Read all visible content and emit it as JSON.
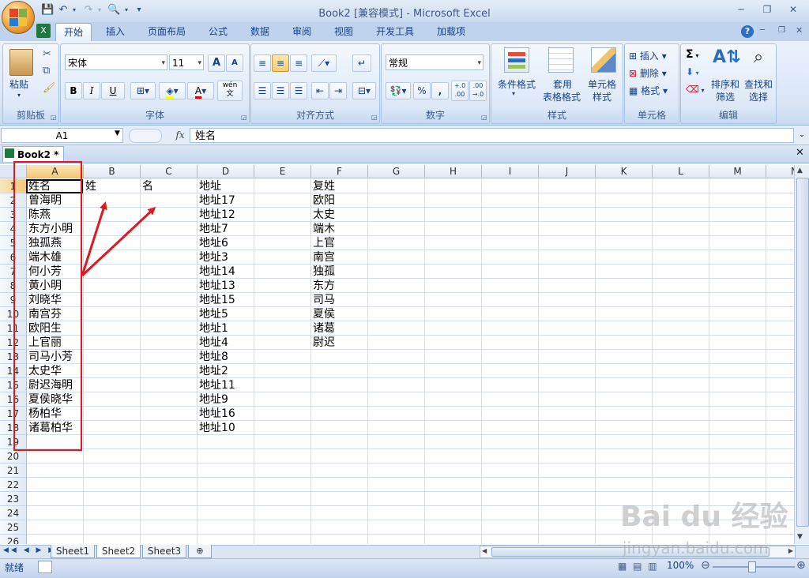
{
  "window": {
    "title": "Book2  [兼容模式] - Microsoft Excel",
    "minimize": "─",
    "restore": "❐",
    "close": "✕"
  },
  "ribbon": {
    "tabs": [
      "开始",
      "插入",
      "页面布局",
      "公式",
      "数据",
      "审阅",
      "视图",
      "开发工具",
      "加载项"
    ],
    "active_tab": "开始",
    "help_icon": "?",
    "groups": {
      "clipboard": {
        "label": "剪贴板",
        "paste": "粘贴"
      },
      "font": {
        "label": "字体",
        "font_name": "宋体",
        "font_size": "11",
        "bold": "B",
        "italic": "I",
        "underline": "U",
        "grow": "A",
        "shrink": "A",
        "wen": "wén\n文"
      },
      "alignment": {
        "label": "对齐方式"
      },
      "number": {
        "label": "数字",
        "format": "常规",
        "percent": "%",
        "comma": ",",
        "inc_dec": "+.0\n.00",
        "dec_dec": ".00\n→.0"
      },
      "styles": {
        "label": "样式",
        "conditional": "条件格式",
        "table_format_line1": "套用",
        "table_format_line2": "表格格式",
        "cell_style_line1": "单元格",
        "cell_style_line2": "样式"
      },
      "cells": {
        "label": "单元格",
        "insert": "插入",
        "delete": "删除",
        "format": "格式"
      },
      "editing": {
        "label": "编辑",
        "sum": "Σ",
        "sort_line1": "排序和",
        "sort_line2": "筛选",
        "find_line1": "查找和",
        "find_line2": "选择"
      }
    }
  },
  "formula_bar": {
    "name_box": "A1",
    "fx": "fx",
    "content": "姓名"
  },
  "workbook_tab": {
    "label": "Book2 *"
  },
  "grid": {
    "columns": [
      "A",
      "B",
      "C",
      "D",
      "E",
      "F",
      "G",
      "H",
      "I",
      "J",
      "K",
      "L",
      "M",
      "N"
    ],
    "rows": [
      "1",
      "2",
      "3",
      "4",
      "5",
      "6",
      "7",
      "8",
      "9",
      "10",
      "11",
      "12",
      "13",
      "14",
      "15",
      "16",
      "17",
      "18",
      "19",
      "20",
      "21",
      "22",
      "23",
      "24",
      "25",
      "26"
    ],
    "col_a": [
      "姓名",
      "曾海明",
      "陈燕",
      "东方小明",
      "独孤燕",
      "端木雄",
      "何小芳",
      "黄小明",
      "刘晓华",
      "南宫芬",
      "欧阳生",
      "上官丽",
      "司马小芳",
      "太史华",
      "尉迟海明",
      "夏侯晓华",
      "杨柏华",
      "诸葛柏华"
    ],
    "col_b": [
      "姓"
    ],
    "col_c": [
      "名"
    ],
    "col_d": [
      "地址",
      "地址17",
      "地址12",
      "地址7",
      "地址6",
      "地址3",
      "地址14",
      "地址13",
      "地址15",
      "地址5",
      "地址1",
      "地址4",
      "地址8",
      "地址2",
      "地址11",
      "地址9",
      "地址16",
      "地址10"
    ],
    "col_f": [
      "复姓",
      "欧阳",
      "太史",
      "端木",
      "上官",
      "南宫",
      "独孤",
      "东方",
      "司马",
      "夏侯",
      "诸葛",
      "尉迟"
    ]
  },
  "sheets": [
    "Sheet1",
    "Sheet2",
    "Sheet3"
  ],
  "active_sheet": "Sheet2",
  "status": {
    "ready": "就绪",
    "zoom": "100%"
  },
  "watermark": {
    "brand": "Bai du 经验",
    "url": "jingyan.baidu.com"
  },
  "colors": {
    "annotation_red": "#e0191e",
    "ribbon_text": "#15428b"
  }
}
